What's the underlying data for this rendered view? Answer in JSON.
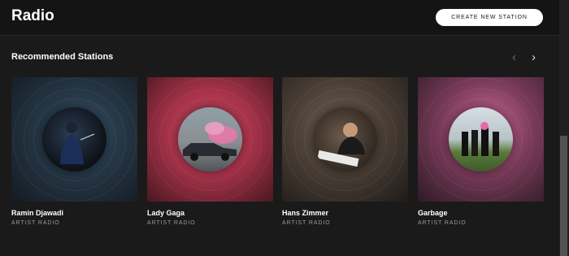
{
  "header": {
    "title": "Radio",
    "create_button": "CREATE NEW STATION"
  },
  "recommended": {
    "title": "Recommended Stations",
    "prev_icon": "chevron-left-icon",
    "next_icon": "chevron-right-icon",
    "stations": [
      {
        "name": "Ramin Djawadi",
        "type": "ARTIST RADIO",
        "cover_color": "#3a5a77"
      },
      {
        "name": "Lady Gaga",
        "type": "ARTIST RADIO",
        "cover_color": "#c13a4e"
      },
      {
        "name": "Hans Zimmer",
        "type": "ARTIST RADIO",
        "cover_color": "#6a5e52"
      },
      {
        "name": "Garbage",
        "type": "ARTIST RADIO",
        "cover_color": "#c45e88"
      }
    ]
  }
}
